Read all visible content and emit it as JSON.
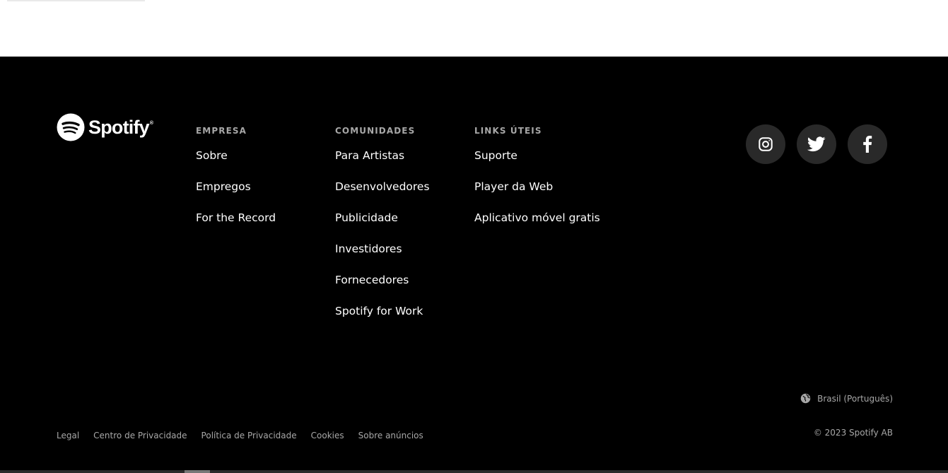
{
  "brand": {
    "name": "Spotify",
    "reg": "®",
    "logo_icon": "spotify-logo-icon"
  },
  "columns": {
    "empresa": {
      "title": "EMPRESA",
      "links": [
        "Sobre",
        "Empregos",
        "For the Record"
      ]
    },
    "comunidades": {
      "title": "COMUNIDADES",
      "links": [
        "Para Artistas",
        "Desenvolvedores",
        "Publicidade",
        "Investidores",
        "Fornecedores",
        "Spotify for Work"
      ]
    },
    "links": {
      "title": "LINKS ÚTEIS",
      "links": [
        "Suporte",
        "Player da Web",
        "Aplicativo móvel gratis"
      ]
    }
  },
  "social": [
    {
      "name": "Instagram",
      "icon": "instagram-icon"
    },
    {
      "name": "Twitter",
      "icon": "twitter-icon"
    },
    {
      "name": "Facebook",
      "icon": "facebook-icon"
    }
  ],
  "locale": {
    "label": "Brasil (Português)",
    "icon": "globe-icon"
  },
  "legal_links": [
    "Legal",
    "Centro de Privacidade",
    "Política de Privacidade",
    "Cookies",
    "Sobre anúncios"
  ],
  "copyright": "© 2023 Spotify AB",
  "colors": {
    "background": "#000000",
    "text": "#ffffff",
    "muted": "#a7a7a7",
    "social_bg": "#292929"
  }
}
